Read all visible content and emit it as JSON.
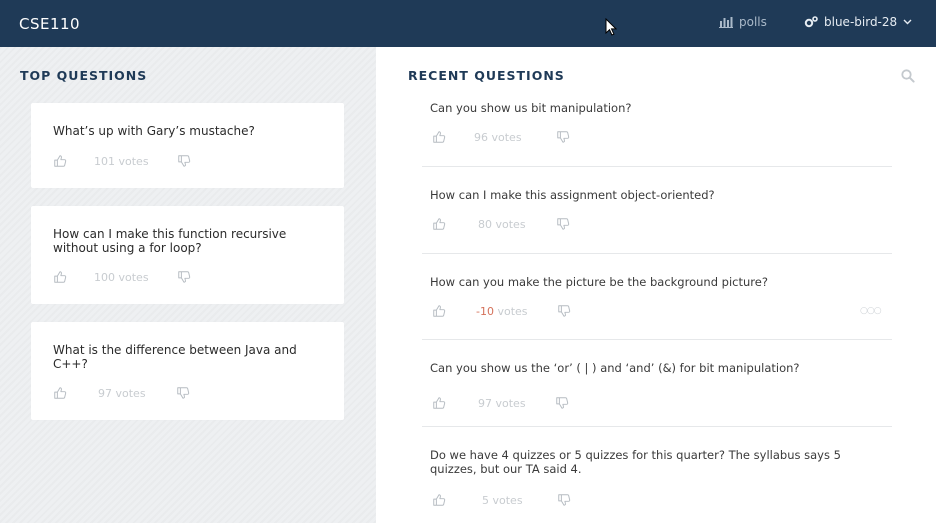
{
  "topbar": {
    "course": "CSE110",
    "polls_label": "polls",
    "user_label": "blue-bird-28"
  },
  "top_questions": {
    "title": "TOP QUESTIONS",
    "items": [
      {
        "question": "What’s up with Gary’s mustache?",
        "votes": "101",
        "votes_suffix": "votes"
      },
      {
        "question": "How can I make this function recursive without using a for loop?",
        "votes": "100",
        "votes_suffix": "votes"
      },
      {
        "question": "What is the difference between Java and C++?",
        "votes": "97",
        "votes_suffix": "votes"
      }
    ]
  },
  "recent_questions": {
    "title": "RECENT QUESTIONS",
    "items": [
      {
        "question": "Can you show us bit manipulation?",
        "votes": "96",
        "votes_suffix": "votes"
      },
      {
        "question": "How can I make this assignment object-oriented?",
        "votes": "80",
        "votes_suffix": "votes"
      },
      {
        "question": "How can you make the picture be the background picture?",
        "votes": "-10",
        "votes_suffix": "votes"
      },
      {
        "question": "Can you show us the ‘or’ ( | ) and ‘and’ (&) for bit manipulation?",
        "votes": "97",
        "votes_suffix": "votes"
      },
      {
        "question": "Do we have 4 quizzes or 5 quizzes for this quarter?  The syllabus says 5 quizzes, but our TA said 4.",
        "votes": "5",
        "votes_suffix": "votes"
      }
    ]
  },
  "icons": {
    "polls": "bar-chart-icon",
    "user": "gears-icon",
    "dropdown": "chevron-down-icon",
    "search": "search-icon",
    "upvote": "thumbs-up-icon",
    "downvote": "thumbs-down-icon",
    "more": "ellipsis-icon",
    "cursor": "mouse-cursor-icon"
  },
  "colors": {
    "topbar": "#1f3a57",
    "section_title": "#1f3a57",
    "negative_votes": "#d4715a",
    "left_panel": "#eef0f2"
  }
}
